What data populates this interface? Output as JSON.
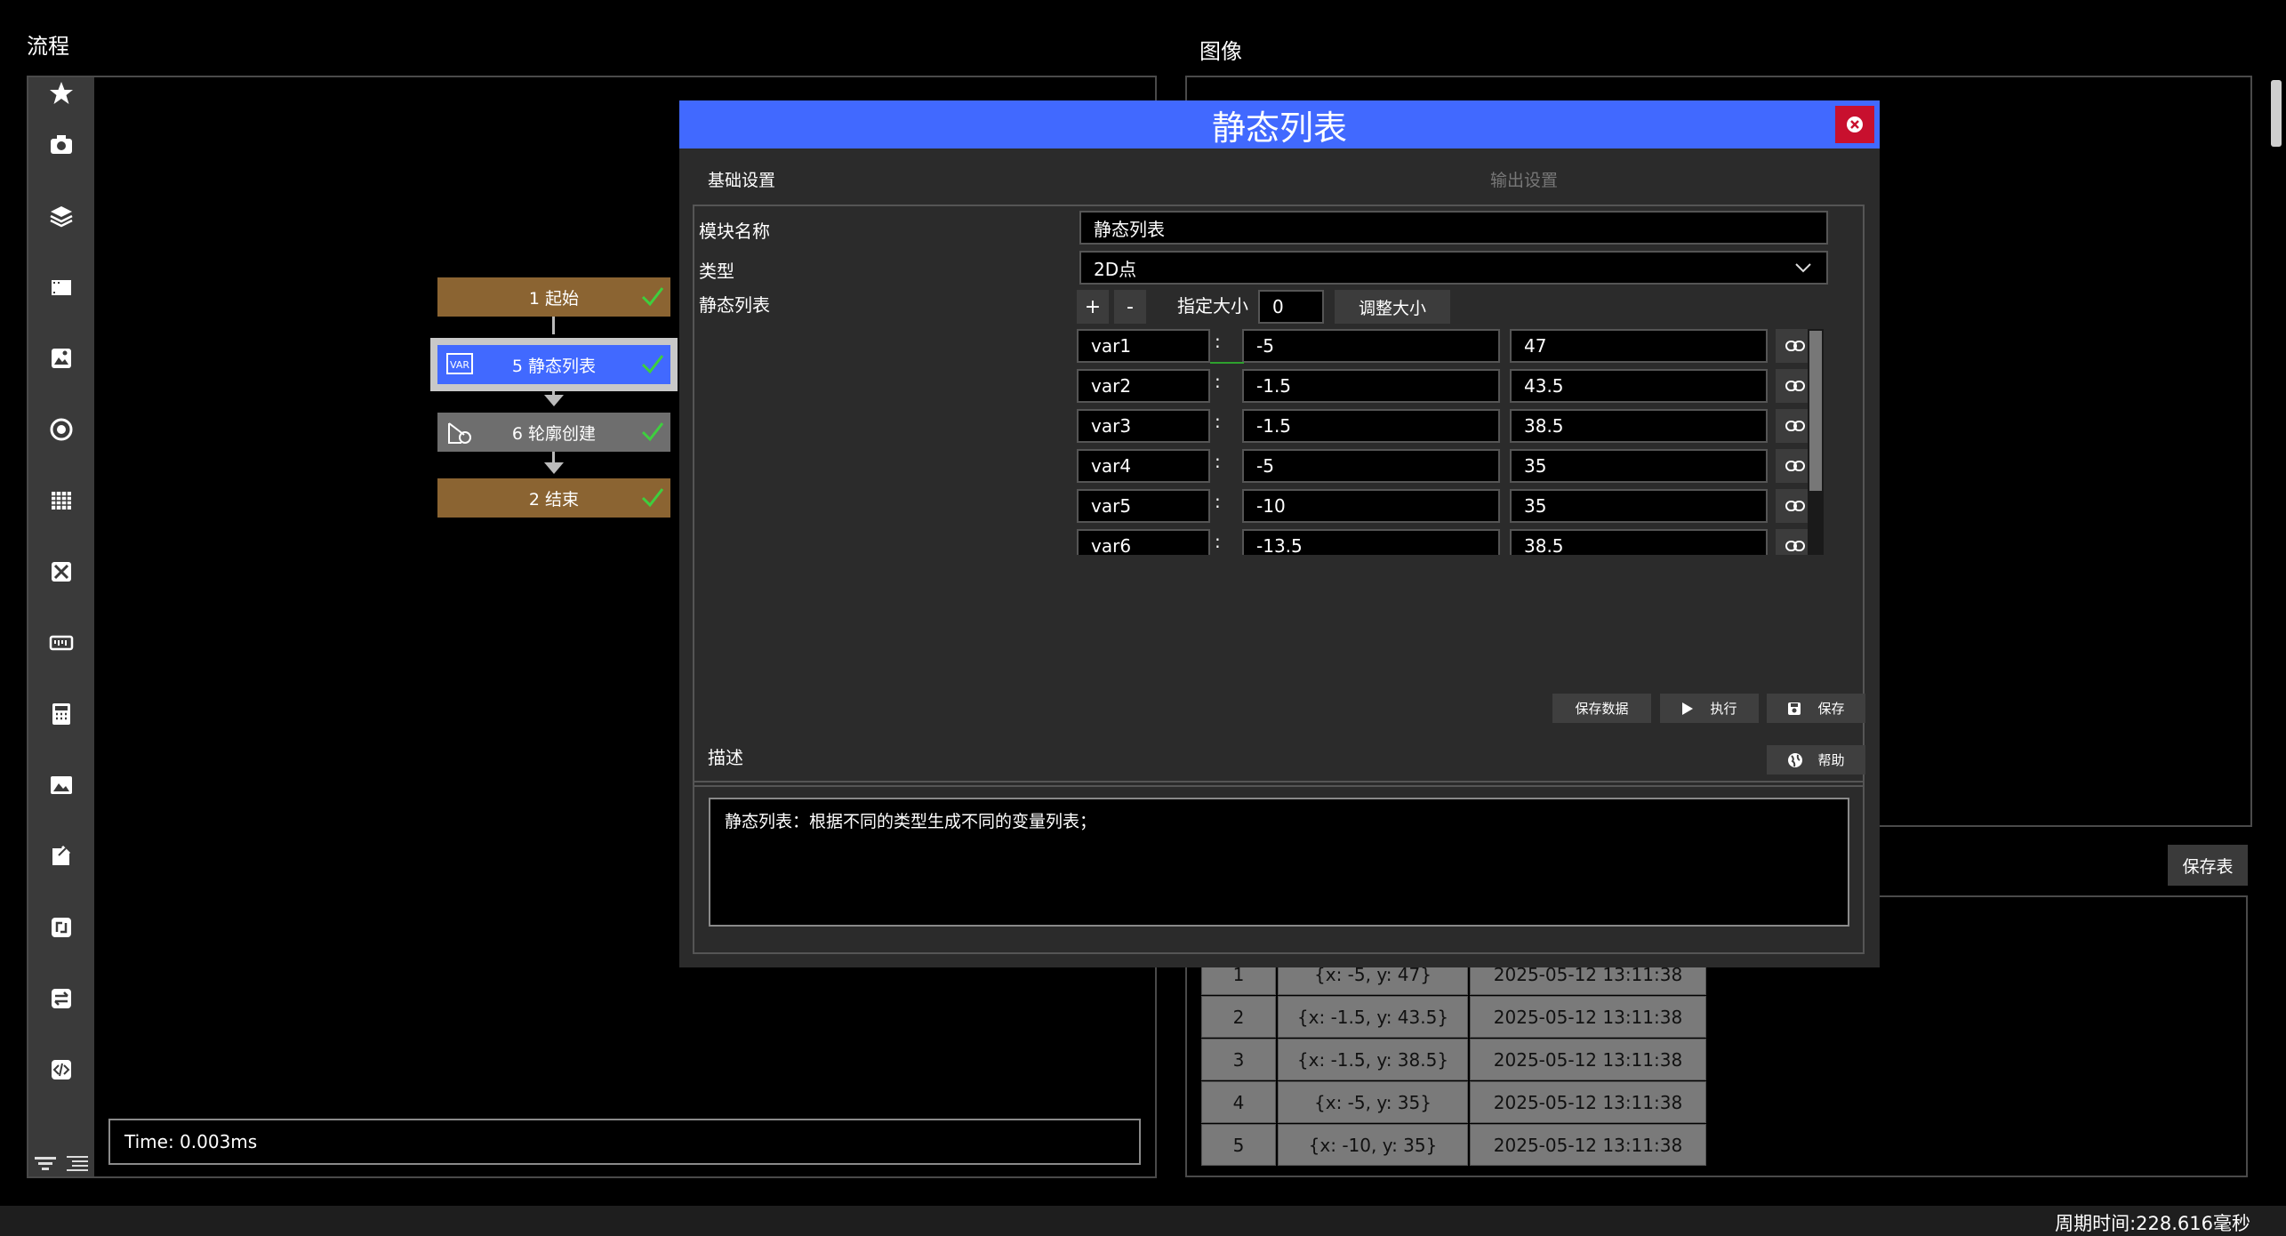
{
  "flow": {
    "title": "流程",
    "time_text": "Time: 0.003ms",
    "nodes": [
      {
        "label": "1 起始",
        "color": "#8b6432"
      },
      {
        "label": "5 静态列表",
        "color": "#4169ff",
        "icon": "var-icon"
      },
      {
        "label": "6 轮廓创建",
        "color": "#6e6e6e",
        "icon": "contour-icon"
      },
      {
        "label": "2 结束",
        "color": "#8b6432"
      }
    ]
  },
  "toolbar_icons": [
    "star-icon",
    "camera-icon",
    "layers-icon",
    "film-icon",
    "image-edit-icon",
    "target-icon",
    "grid-icon",
    "tools-icon",
    "ruler-icon",
    "calculator-icon",
    "picture-icon",
    "export-icon",
    "loop-icon",
    "swap-icon",
    "code-icon"
  ],
  "image_panel": {
    "title": "图像",
    "save_table_label": "保存表"
  },
  "table": {
    "rows": [
      [
        "1",
        "{x: -5, y: 47}",
        "2025-05-12 13:11:38"
      ],
      [
        "2",
        "{x: -1.5, y: 43.5}",
        "2025-05-12 13:11:38"
      ],
      [
        "3",
        "{x: -1.5, y: 38.5}",
        "2025-05-12 13:11:38"
      ],
      [
        "4",
        "{x: -5, y: 35}",
        "2025-05-12 13:11:38"
      ],
      [
        "5",
        "{x: -10, y: 35}",
        "2025-05-12 13:11:38"
      ]
    ]
  },
  "status": {
    "cycle_time": "周期时间:228.616毫秒"
  },
  "dialog": {
    "title": "静态列表",
    "tab_basic": "基础设置",
    "tab_output": "输出设置",
    "module_name_label": "模块名称",
    "module_name_value": "静态列表",
    "type_label": "类型",
    "type_value": "2D点",
    "list_label": "静态列表",
    "plus_label": "+",
    "minus_label": "-",
    "size_label": "指定大小",
    "size_value": "0",
    "resize_label": "调整大小",
    "colon": ":",
    "vars": [
      {
        "name": "var1",
        "x": "-5",
        "y": "47"
      },
      {
        "name": "var2",
        "x": "-1.5",
        "y": "43.5"
      },
      {
        "name": "var3",
        "x": "-1.5",
        "y": "38.5"
      },
      {
        "name": "var4",
        "x": "-5",
        "y": "35"
      },
      {
        "name": "var5",
        "x": "-10",
        "y": "35"
      },
      {
        "name": "var6",
        "x": "-13.5",
        "y": "38.5"
      }
    ],
    "save_data_label": "保存数据",
    "run_label": "执行",
    "save_label": "保存",
    "desc_label": "描述",
    "help_label": "帮助",
    "desc_text": "静态列表：根据不同的类型生成不同的变量列表；",
    "title_bar_color": "#4169ff",
    "close_color": "#c8102e"
  }
}
